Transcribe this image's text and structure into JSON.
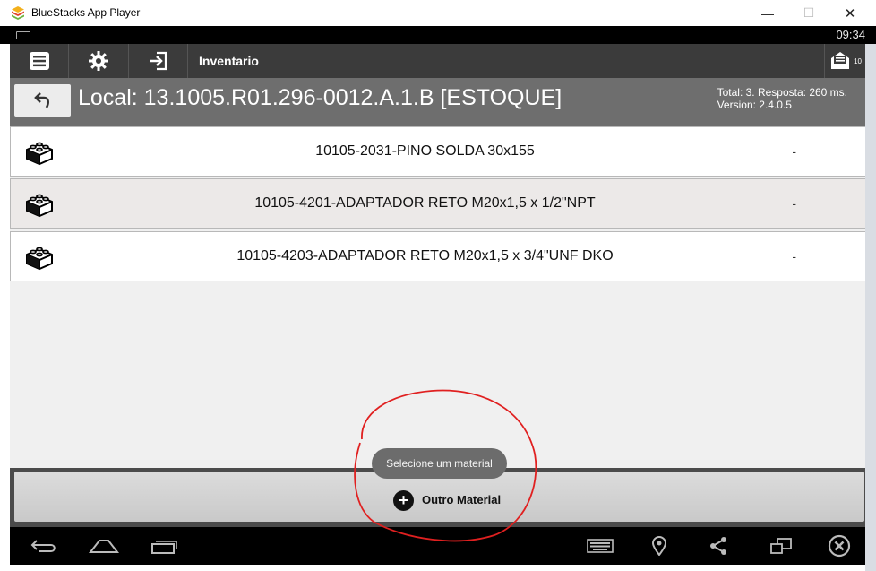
{
  "window": {
    "title": "BlueStacks App Player",
    "minimize_glyph": "—",
    "maximize_glyph": "☐",
    "close_glyph": "✕"
  },
  "status_bar": {
    "time": "09:34"
  },
  "toolbar": {
    "title": "Inventario",
    "message_badge": "10"
  },
  "header": {
    "location": "Local: 13.1005.R01.296-0012.A.1.B [ESTOQUE]",
    "total_line": "Total: 3. Resposta: 260 ms.",
    "version_line": "Version: 2.4.0.5"
  },
  "items": [
    {
      "name": "10105-2031-PINO SOLDA 30x155",
      "value": "-"
    },
    {
      "name": "10105-4201-ADAPTADOR RETO M20x1,5 x 1/2\"NPT",
      "value": "-"
    },
    {
      "name": "10105-4203-ADAPTADOR RETO M20x1,5 x 3/4\"UNF DKO",
      "value": "-"
    }
  ],
  "toast": "Selecione um material",
  "action": {
    "label": "Outro Material",
    "icon": "+"
  },
  "colors": {
    "toolbar": "#3b3b3b",
    "header": "#6e6e6e",
    "annotation": "#e02020"
  }
}
